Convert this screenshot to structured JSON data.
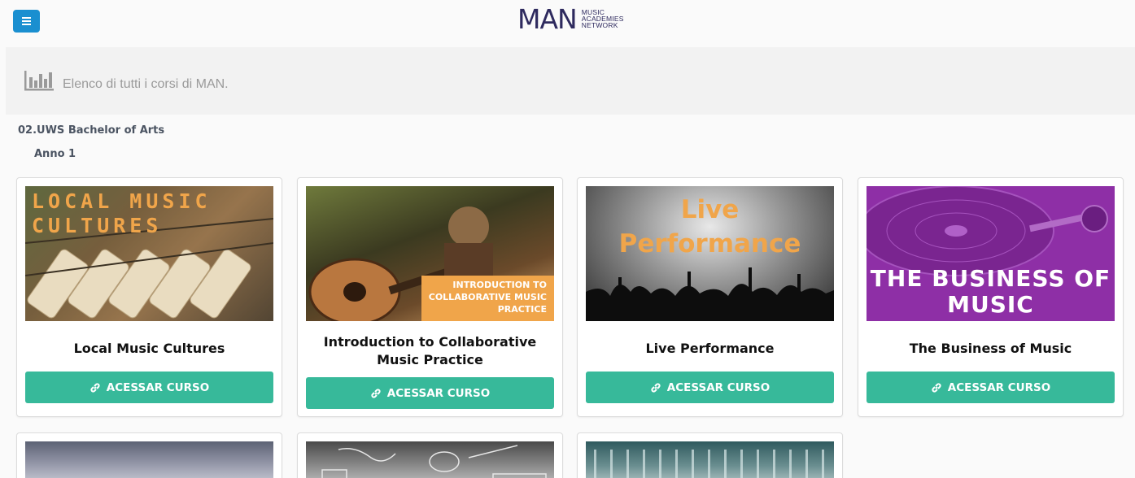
{
  "header": {
    "logo_main": "MAN",
    "logo_sub_1": "MUSIC",
    "logo_sub_2": "ACADEMIES",
    "logo_sub_3": "NETWORK",
    "menu_icon": "hamburger-menu-icon",
    "accent_color": "#1a8fd0"
  },
  "banner": {
    "icon": "bar-chart-icon",
    "text": "Elenco di tutti i corsi di MAN."
  },
  "program": {
    "name": "02.UWS Bachelor of Arts",
    "year": "Anno 1"
  },
  "button_color": "#37b99a",
  "courses": [
    {
      "title": "Local Music Cultures",
      "image_text_1": "LOCAL MUSIC",
      "image_text_2": "CULTURES",
      "button": "ACESSAR CURSO"
    },
    {
      "title": "Introduction to Collaborative Music Practice",
      "image_text_1": "INTRODUCTION TO",
      "image_text_2": "COLLABORATIVE MUSIC",
      "image_text_3": "PRACTICE",
      "button": "ACESSAR CURSO"
    },
    {
      "title": "Live Performance",
      "image_text_1": "Live",
      "image_text_2": "Performance",
      "button": "ACESSAR CURSO"
    },
    {
      "title": "The Business of Music",
      "image_text_1": "THE BUSINESS OF",
      "image_text_2": "MUSIC",
      "button": "ACESSAR CURSO"
    }
  ]
}
